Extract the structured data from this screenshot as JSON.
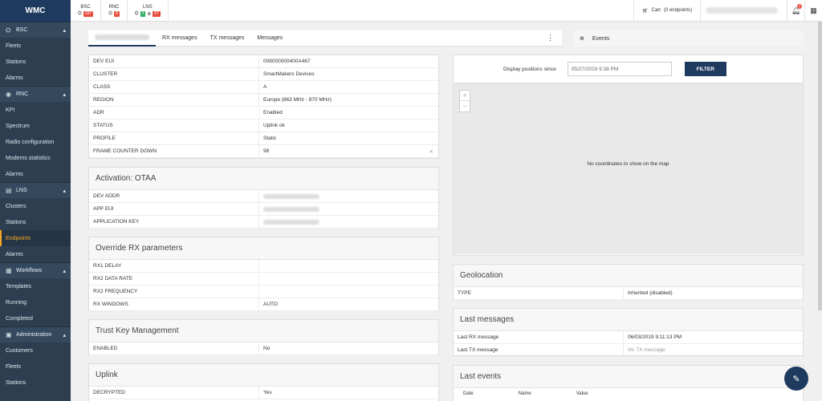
{
  "app": {
    "logo": "WMC"
  },
  "sidebar": {
    "sections": [
      {
        "label": "BSC",
        "icon": "bsc-icon",
        "items": [
          "Fleets",
          "Stations",
          "Alarms"
        ]
      },
      {
        "label": "RNC",
        "icon": "rnc-icon",
        "items": [
          "KPI",
          "Spectrum",
          "Radio configuration",
          "Modems statistics",
          "Alarms"
        ]
      },
      {
        "label": "LNS",
        "icon": "lns-icon",
        "items": [
          "Clusters",
          "Stations",
          "Endpoints",
          "Alarms"
        ]
      },
      {
        "label": "Workflows",
        "icon": "workflows-icon",
        "items": [
          "Templates",
          "Running",
          "Completed"
        ]
      },
      {
        "label": "Administration",
        "icon": "admin-icon",
        "items": [
          "Customers",
          "Fleets",
          "Stations"
        ]
      }
    ],
    "active_item": "Endpoints"
  },
  "topbar": {
    "bsc": {
      "label": "BSC",
      "count": "297"
    },
    "rnc": {
      "label": "RNC",
      "count": "8"
    },
    "lns": {
      "label": "LNS",
      "count_green": "3",
      "count_red": "67"
    },
    "cart_label": "Cart",
    "cart_count": "(0 endpoints)",
    "notifications": "3"
  },
  "tabs": [
    "RX messages",
    "TX messages",
    "Messages"
  ],
  "events_tab": "Events",
  "details": [
    {
      "k": "DEV EUI",
      "v": "008000000400A467"
    },
    {
      "k": "CLUSTER",
      "v": "SmartMakers Devices"
    },
    {
      "k": "CLASS",
      "v": "A"
    },
    {
      "k": "REGION",
      "v": "Europe (863 MHz - 870 MHz)"
    },
    {
      "k": "ADR",
      "v": "Enabled"
    },
    {
      "k": "STATUS",
      "v": "Uplink ok"
    },
    {
      "k": "PROFILE",
      "v": "Static"
    },
    {
      "k": "FRAME COUNTER DOWN",
      "v": "98"
    }
  ],
  "activation": {
    "title": "Activation: OTAA",
    "rows": [
      "DEV ADDR",
      "APP EUI",
      "APPLICATION KEY"
    ]
  },
  "override": {
    "title": "Override RX parameters",
    "rows": [
      {
        "k": "RX1 DELAY",
        "v": ""
      },
      {
        "k": "RX2 DATA RATE",
        "v": ""
      },
      {
        "k": "RX2 FREQUENCY",
        "v": ""
      },
      {
        "k": "RX WINDOWS",
        "v": "AUTO"
      }
    ]
  },
  "trust": {
    "title": "Trust Key Management",
    "rows": [
      {
        "k": "ENABLED",
        "v": "No"
      }
    ]
  },
  "uplink": {
    "title": "Uplink",
    "rows": [
      {
        "k": "DECRYPTED",
        "v": "Yes"
      }
    ]
  },
  "map": {
    "filter_label": "Display positions since",
    "date": "05/27/2019 9:38 PM",
    "filter_button": "FILTER",
    "empty": "No coordinates to show on the map"
  },
  "geolocation": {
    "title": "Geolocation",
    "rows": [
      {
        "k": "TYPE",
        "v": "Inherited (disabled)"
      }
    ]
  },
  "last_messages": {
    "title": "Last messages",
    "rows": [
      {
        "k": "Last RX message",
        "v": "06/03/2019 9:11:13 PM"
      },
      {
        "k": "Last TX message",
        "v": "No TX message"
      }
    ]
  },
  "last_events": {
    "title": "Last events",
    "cols": [
      "Date",
      "Name",
      "Value"
    ]
  }
}
